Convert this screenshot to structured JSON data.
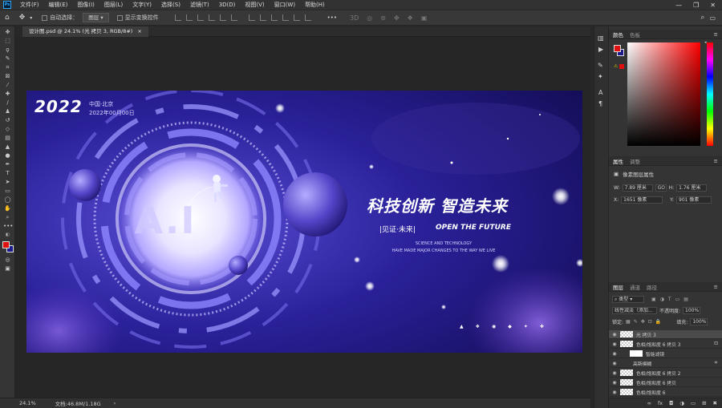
{
  "app": {
    "logo": "Ps"
  },
  "menu": [
    "文件(F)",
    "编辑(E)",
    "图像(I)",
    "图层(L)",
    "文字(Y)",
    "选择(S)",
    "滤镜(T)",
    "3D(D)",
    "视图(V)",
    "窗口(W)",
    "帮助(H)"
  ],
  "window_controls": [
    "—",
    "❐",
    "✕"
  ],
  "options": {
    "auto_select_label": "自动选择：",
    "auto_select_value": "图层",
    "transform_label": "显示变换控件",
    "more": "•••"
  },
  "document": {
    "tab_title": "设计图.psd @ 24.1% (光 拷贝 3, RGB/8#)",
    "tab_close": "×"
  },
  "status": {
    "zoom": "24.1%",
    "doc_size": "文档:46.8M/1.18G"
  },
  "canvas": {
    "year": "2022",
    "location": "中国·北京",
    "date": "2022年00月00日",
    "ai_text": "A.I",
    "headline": "科技创新 智造未来",
    "sub_cn": "|见证·未来|",
    "sub_en": "OPEN THE FUTURE",
    "small1": "SCIENCE AND TECHNOLOGY",
    "small2": "HAVE MADE MAJOR CHANGES TO THE WAY WE LIVE",
    "icon_count": 6
  },
  "color_panel": {
    "tabs": [
      "颜色",
      "色板"
    ],
    "fg_color": "#e01010",
    "bg_color": "#1a1a8a",
    "hue_color": "#ff0000"
  },
  "properties_panel": {
    "tabs": [
      "属性",
      "调整"
    ],
    "title": "像素图层属性",
    "w_label": "W:",
    "w_value": "7.89 厘米",
    "link": "GO",
    "h_label": "H:",
    "h_value": "1.76 厘米",
    "x_label": "X:",
    "x_value": "1651 像素",
    "y_label": "Y:",
    "y_value": "901 像素"
  },
  "layers_panel": {
    "tabs": [
      "图层",
      "通道",
      "路径"
    ],
    "filter_label": "类型",
    "blend_mode": "线性减淡（添加...",
    "opacity_label": "不透明度:",
    "opacity_value": "100%",
    "lock_label": "锁定:",
    "fill_label": "填充:",
    "fill_value": "100%",
    "layers": [
      {
        "name": "光 拷贝 3",
        "selected": true
      },
      {
        "name": "色相/饱和度 6 拷贝 3",
        "selected": false
      },
      {
        "name": "智能滤镜",
        "selected": false
      },
      {
        "name": "高斯模糊",
        "selected": false
      },
      {
        "name": "色相/饱和度 6 拷贝 2",
        "selected": false
      },
      {
        "name": "色相/饱和度 6 拷贝",
        "selected": false
      },
      {
        "name": "色相/饱和度 6",
        "selected": false
      }
    ],
    "footer_icons": "ɑ fx ◘ ◑ ▭ ⊞ 🗑"
  }
}
